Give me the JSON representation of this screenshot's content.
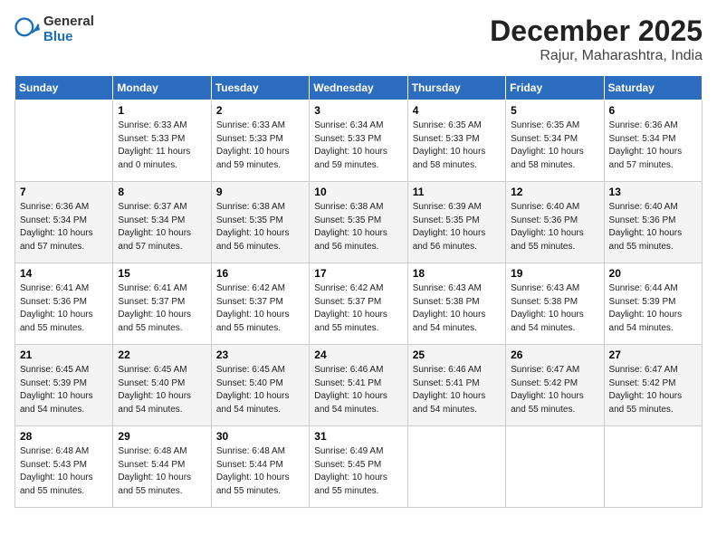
{
  "header": {
    "logo_general": "General",
    "logo_blue": "Blue",
    "month": "December 2025",
    "location": "Rajur, Maharashtra, India"
  },
  "weekdays": [
    "Sunday",
    "Monday",
    "Tuesday",
    "Wednesday",
    "Thursday",
    "Friday",
    "Saturday"
  ],
  "weeks": [
    [
      {
        "day": "",
        "sunrise": "",
        "sunset": "",
        "daylight": ""
      },
      {
        "day": "1",
        "sunrise": "Sunrise: 6:33 AM",
        "sunset": "Sunset: 5:33 PM",
        "daylight": "Daylight: 11 hours and 0 minutes."
      },
      {
        "day": "2",
        "sunrise": "Sunrise: 6:33 AM",
        "sunset": "Sunset: 5:33 PM",
        "daylight": "Daylight: 10 hours and 59 minutes."
      },
      {
        "day": "3",
        "sunrise": "Sunrise: 6:34 AM",
        "sunset": "Sunset: 5:33 PM",
        "daylight": "Daylight: 10 hours and 59 minutes."
      },
      {
        "day": "4",
        "sunrise": "Sunrise: 6:35 AM",
        "sunset": "Sunset: 5:33 PM",
        "daylight": "Daylight: 10 hours and 58 minutes."
      },
      {
        "day": "5",
        "sunrise": "Sunrise: 6:35 AM",
        "sunset": "Sunset: 5:34 PM",
        "daylight": "Daylight: 10 hours and 58 minutes."
      },
      {
        "day": "6",
        "sunrise": "Sunrise: 6:36 AM",
        "sunset": "Sunset: 5:34 PM",
        "daylight": "Daylight: 10 hours and 57 minutes."
      }
    ],
    [
      {
        "day": "7",
        "sunrise": "Sunrise: 6:36 AM",
        "sunset": "Sunset: 5:34 PM",
        "daylight": "Daylight: 10 hours and 57 minutes."
      },
      {
        "day": "8",
        "sunrise": "Sunrise: 6:37 AM",
        "sunset": "Sunset: 5:34 PM",
        "daylight": "Daylight: 10 hours and 57 minutes."
      },
      {
        "day": "9",
        "sunrise": "Sunrise: 6:38 AM",
        "sunset": "Sunset: 5:35 PM",
        "daylight": "Daylight: 10 hours and 56 minutes."
      },
      {
        "day": "10",
        "sunrise": "Sunrise: 6:38 AM",
        "sunset": "Sunset: 5:35 PM",
        "daylight": "Daylight: 10 hours and 56 minutes."
      },
      {
        "day": "11",
        "sunrise": "Sunrise: 6:39 AM",
        "sunset": "Sunset: 5:35 PM",
        "daylight": "Daylight: 10 hours and 56 minutes."
      },
      {
        "day": "12",
        "sunrise": "Sunrise: 6:40 AM",
        "sunset": "Sunset: 5:36 PM",
        "daylight": "Daylight: 10 hours and 55 minutes."
      },
      {
        "day": "13",
        "sunrise": "Sunrise: 6:40 AM",
        "sunset": "Sunset: 5:36 PM",
        "daylight": "Daylight: 10 hours and 55 minutes."
      }
    ],
    [
      {
        "day": "14",
        "sunrise": "Sunrise: 6:41 AM",
        "sunset": "Sunset: 5:36 PM",
        "daylight": "Daylight: 10 hours and 55 minutes."
      },
      {
        "day": "15",
        "sunrise": "Sunrise: 6:41 AM",
        "sunset": "Sunset: 5:37 PM",
        "daylight": "Daylight: 10 hours and 55 minutes."
      },
      {
        "day": "16",
        "sunrise": "Sunrise: 6:42 AM",
        "sunset": "Sunset: 5:37 PM",
        "daylight": "Daylight: 10 hours and 55 minutes."
      },
      {
        "day": "17",
        "sunrise": "Sunrise: 6:42 AM",
        "sunset": "Sunset: 5:37 PM",
        "daylight": "Daylight: 10 hours and 55 minutes."
      },
      {
        "day": "18",
        "sunrise": "Sunrise: 6:43 AM",
        "sunset": "Sunset: 5:38 PM",
        "daylight": "Daylight: 10 hours and 54 minutes."
      },
      {
        "day": "19",
        "sunrise": "Sunrise: 6:43 AM",
        "sunset": "Sunset: 5:38 PM",
        "daylight": "Daylight: 10 hours and 54 minutes."
      },
      {
        "day": "20",
        "sunrise": "Sunrise: 6:44 AM",
        "sunset": "Sunset: 5:39 PM",
        "daylight": "Daylight: 10 hours and 54 minutes."
      }
    ],
    [
      {
        "day": "21",
        "sunrise": "Sunrise: 6:45 AM",
        "sunset": "Sunset: 5:39 PM",
        "daylight": "Daylight: 10 hours and 54 minutes."
      },
      {
        "day": "22",
        "sunrise": "Sunrise: 6:45 AM",
        "sunset": "Sunset: 5:40 PM",
        "daylight": "Daylight: 10 hours and 54 minutes."
      },
      {
        "day": "23",
        "sunrise": "Sunrise: 6:45 AM",
        "sunset": "Sunset: 5:40 PM",
        "daylight": "Daylight: 10 hours and 54 minutes."
      },
      {
        "day": "24",
        "sunrise": "Sunrise: 6:46 AM",
        "sunset": "Sunset: 5:41 PM",
        "daylight": "Daylight: 10 hours and 54 minutes."
      },
      {
        "day": "25",
        "sunrise": "Sunrise: 6:46 AM",
        "sunset": "Sunset: 5:41 PM",
        "daylight": "Daylight: 10 hours and 54 minutes."
      },
      {
        "day": "26",
        "sunrise": "Sunrise: 6:47 AM",
        "sunset": "Sunset: 5:42 PM",
        "daylight": "Daylight: 10 hours and 55 minutes."
      },
      {
        "day": "27",
        "sunrise": "Sunrise: 6:47 AM",
        "sunset": "Sunset: 5:42 PM",
        "daylight": "Daylight: 10 hours and 55 minutes."
      }
    ],
    [
      {
        "day": "28",
        "sunrise": "Sunrise: 6:48 AM",
        "sunset": "Sunset: 5:43 PM",
        "daylight": "Daylight: 10 hours and 55 minutes."
      },
      {
        "day": "29",
        "sunrise": "Sunrise: 6:48 AM",
        "sunset": "Sunset: 5:44 PM",
        "daylight": "Daylight: 10 hours and 55 minutes."
      },
      {
        "day": "30",
        "sunrise": "Sunrise: 6:48 AM",
        "sunset": "Sunset: 5:44 PM",
        "daylight": "Daylight: 10 hours and 55 minutes."
      },
      {
        "day": "31",
        "sunrise": "Sunrise: 6:49 AM",
        "sunset": "Sunset: 5:45 PM",
        "daylight": "Daylight: 10 hours and 55 minutes."
      },
      {
        "day": "",
        "sunrise": "",
        "sunset": "",
        "daylight": ""
      },
      {
        "day": "",
        "sunrise": "",
        "sunset": "",
        "daylight": ""
      },
      {
        "day": "",
        "sunrise": "",
        "sunset": "",
        "daylight": ""
      }
    ]
  ]
}
